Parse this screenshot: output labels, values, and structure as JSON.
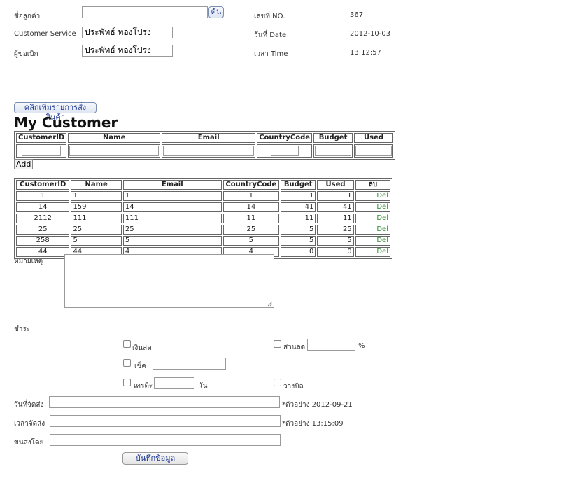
{
  "header": {
    "customer_label": "ชื่อลูกค้า",
    "customer_value": "",
    "search_button": "ค้น",
    "service_label": "Customer Service",
    "service_value": "ประพัทธ์ ทองโปร่ง",
    "requester_label": "ผู้ขอเบิก",
    "requester_value": "ประพัทธ์ ทองโปร่ง",
    "no_label": "เลขที่ NO.",
    "no_value": "367",
    "date_label": "วันที่ Date",
    "date_value": "2012-10-03",
    "time_label": "เวลา Time",
    "time_value": "13:12:57"
  },
  "add_items_button": "คลิกเพิ่มรายการสั่งสินค้า",
  "title": "My Customer",
  "entry_table": {
    "headers": [
      "CustomerID",
      "Name",
      "Email",
      "CountryCode",
      "Budget",
      "Used"
    ],
    "add_button": "Add"
  },
  "list_table": {
    "headers": [
      "CustomerID",
      "Name",
      "Email",
      "CountryCode",
      "Budget",
      "Used",
      "ลบ"
    ],
    "rows": [
      {
        "id": "1",
        "name": "1",
        "email": "1",
        "country": "1",
        "budget": "1",
        "used": "1",
        "del": "Del"
      },
      {
        "id": "14",
        "name": "159",
        "email": "14",
        "country": "14",
        "budget": "41",
        "used": "41",
        "del": "Del"
      },
      {
        "id": "2112",
        "name": "111",
        "email": "111",
        "country": "11",
        "budget": "11",
        "used": "11",
        "del": "Del"
      },
      {
        "id": "25",
        "name": "25",
        "email": "25",
        "country": "25",
        "budget": "5",
        "used": "25",
        "del": "Del"
      },
      {
        "id": "258",
        "name": "5",
        "email": "5",
        "country": "5",
        "budget": "5",
        "used": "5",
        "del": "Del"
      },
      {
        "id": "44",
        "name": "44",
        "email": "4",
        "country": "4",
        "budget": "0",
        "used": "0",
        "del": "Del"
      }
    ]
  },
  "remark_label": "หมายเหตุ",
  "payment": {
    "label": "ชำระ",
    "cash": "เงินสด",
    "discount": "ส่วนลด",
    "percent": "%",
    "cheque": "เช็ค",
    "credit": "เครดิต",
    "days": "วัน",
    "bill": "วางบิล"
  },
  "delivery": {
    "date_label": "วันที่จัดส่ง",
    "date_hint": "*ตัวอย่าง 2012-09-21",
    "time_label": "เวลาจัดส่ง",
    "time_hint": "*ตัวอย่าง 13:15:09",
    "by_label": "ขนส่งโดย"
  },
  "save_button": "บันทึกข้อมูล"
}
